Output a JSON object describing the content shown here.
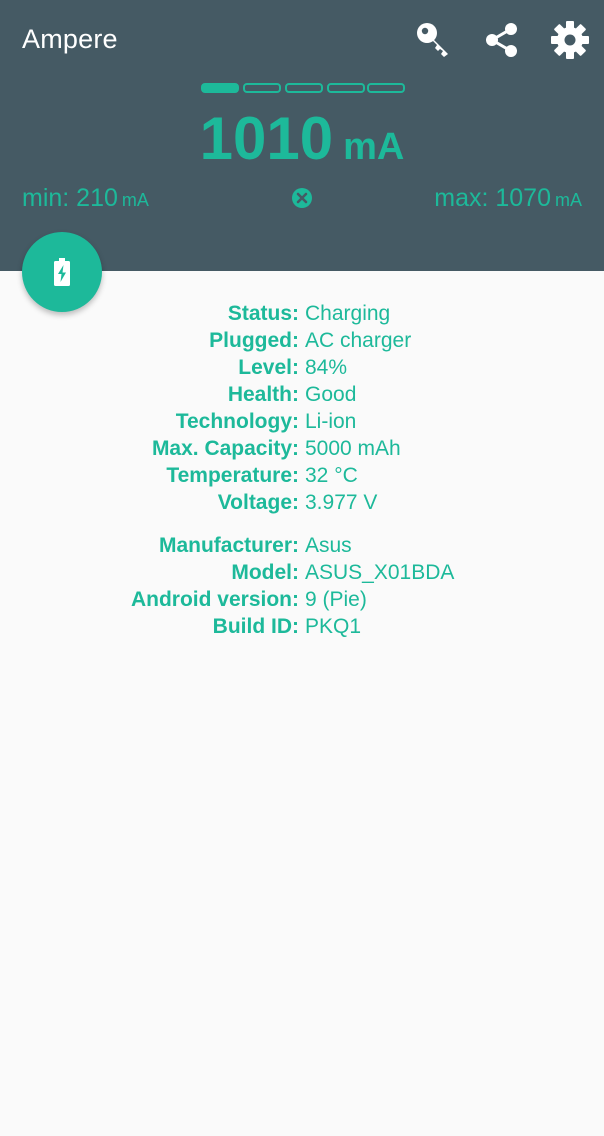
{
  "app": {
    "title": "Ampere"
  },
  "toolbar": {
    "actions": [
      {
        "icon": "key-icon"
      },
      {
        "icon": "share-icon"
      },
      {
        "icon": "gear-icon"
      }
    ]
  },
  "pager": {
    "pages": 5,
    "active_index": 0
  },
  "current": {
    "value": "1010",
    "unit": "mA"
  },
  "range": {
    "min_label": "min: 210",
    "min_unit": "mA",
    "max_label": "max: 1070",
    "max_unit": "mA"
  },
  "battery_info": [
    {
      "label": "Status:",
      "value": "Charging"
    },
    {
      "label": "Plugged:",
      "value": "AC charger"
    },
    {
      "label": "Level:",
      "value": "84%"
    },
    {
      "label": "Health:",
      "value": "Good"
    },
    {
      "label": "Technology:",
      "value": "Li-ion"
    },
    {
      "label": "Max. Capacity:",
      "value": "5000 mAh"
    },
    {
      "label": "Temperature:",
      "value": "32 °C"
    },
    {
      "label": "Voltage:",
      "value": "3.977 V"
    }
  ],
  "device_info": [
    {
      "label": "Manufacturer:",
      "value": "Asus"
    },
    {
      "label": "Model:",
      "value": "ASUS_X01BDA"
    },
    {
      "label": "Android version:",
      "value": "9 (Pie)"
    },
    {
      "label": "Build ID:",
      "value": "PKQ1"
    }
  ],
  "colors": {
    "header_bg": "#455a64",
    "accent": "#1db99a",
    "page_bg": "#fafafa"
  }
}
